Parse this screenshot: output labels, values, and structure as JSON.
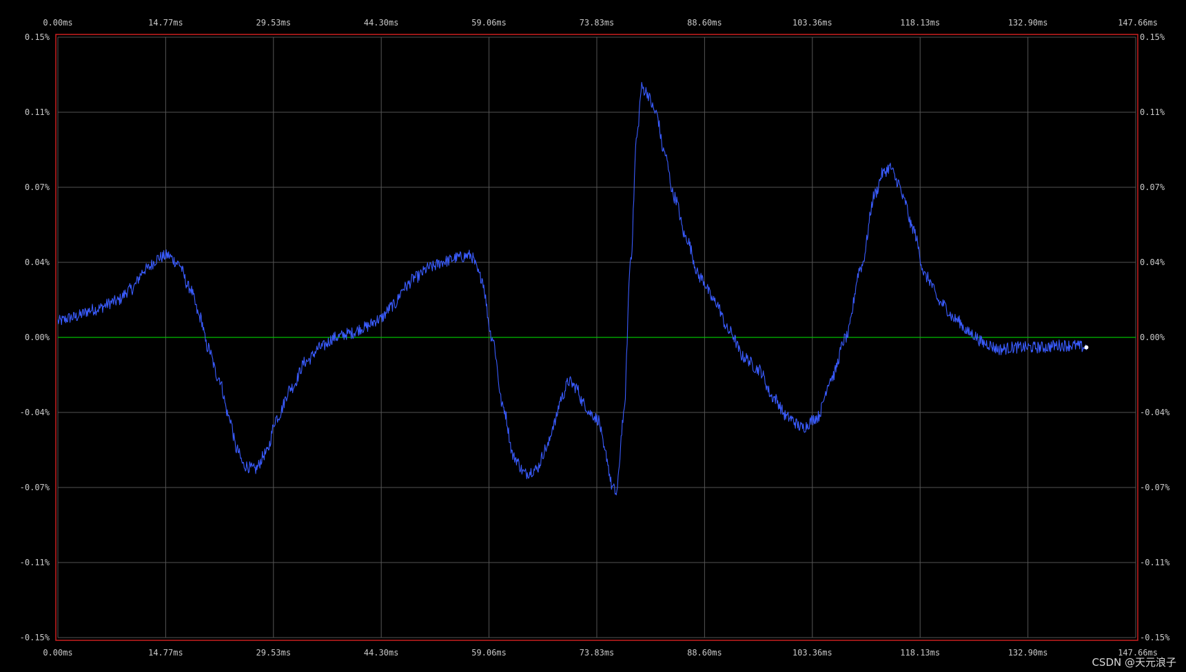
{
  "chart_data": {
    "type": "line",
    "title": "",
    "xlabel": "",
    "ylabel": "",
    "x_unit": "ms",
    "y_unit": "%",
    "xlim": [
      0,
      147.66
    ],
    "ylim": [
      -0.15,
      0.15
    ],
    "x_ticks": [
      "0.00ms",
      "14.77ms",
      "29.53ms",
      "44.30ms",
      "59.06ms",
      "73.83ms",
      "88.60ms",
      "103.36ms",
      "118.13ms",
      "132.90ms",
      "147.66ms"
    ],
    "y_ticks": [
      "0.15%",
      "0.11%",
      "0.07%",
      "0.04%",
      "0.00%",
      "-0.04%",
      "-0.07%",
      "-0.11%",
      "-0.15%"
    ],
    "grid": true,
    "reference_line": {
      "y": 0.0,
      "color": "#00c000"
    },
    "series": [
      {
        "color": "#3a5cff",
        "noise_amplitude": 0.003,
        "x": [
          0,
          2,
          5,
          8,
          10,
          12,
          14,
          15,
          16.5,
          18,
          19.5,
          20.5,
          22,
          23.5,
          24.5,
          25.5,
          27,
          28.5,
          30,
          32,
          34,
          36,
          38,
          40,
          42,
          44,
          46,
          47.5,
          49,
          51,
          53,
          55,
          56.5,
          58,
          59.5,
          61,
          62.5,
          64,
          65.5,
          67,
          68,
          69,
          70,
          71,
          72,
          73,
          74,
          75,
          76,
          76.5,
          77.5,
          78.5,
          79.3,
          80,
          80.5,
          82,
          83,
          84.5,
          86,
          88,
          90,
          92,
          94,
          96,
          98,
          100,
          102,
          104,
          106,
          108,
          110,
          112,
          113,
          114,
          115,
          116,
          117,
          119,
          121,
          123,
          125,
          127,
          129,
          131,
          133,
          135,
          137,
          139,
          140.9
        ],
        "y": [
          0.008,
          0.01,
          0.014,
          0.018,
          0.024,
          0.034,
          0.04,
          0.041,
          0.037,
          0.025,
          0.01,
          -0.005,
          -0.02,
          -0.04,
          -0.056,
          -0.064,
          -0.066,
          -0.058,
          -0.04,
          -0.025,
          -0.012,
          -0.005,
          0.0,
          0.002,
          0.005,
          0.009,
          0.016,
          0.025,
          0.03,
          0.035,
          0.038,
          0.04,
          0.041,
          0.03,
          0.0,
          -0.035,
          -0.06,
          -0.068,
          -0.066,
          -0.055,
          -0.043,
          -0.03,
          -0.022,
          -0.025,
          -0.033,
          -0.038,
          -0.041,
          -0.058,
          -0.075,
          -0.078,
          -0.04,
          0.04,
          0.1,
          0.125,
          0.123,
          0.112,
          0.093,
          0.07,
          0.05,
          0.03,
          0.018,
          0.003,
          -0.01,
          -0.016,
          -0.03,
          -0.04,
          -0.045,
          -0.04,
          -0.02,
          0.0,
          0.035,
          0.072,
          0.082,
          0.085,
          0.078,
          0.068,
          0.055,
          0.03,
          0.017,
          0.009,
          0.002,
          -0.003,
          -0.006,
          -0.005,
          -0.005,
          -0.005,
          -0.004,
          -0.004,
          -0.005
        ]
      }
    ],
    "end_marker": {
      "x": 140.9,
      "y": -0.005,
      "color": "#ffffff"
    }
  },
  "watermark": "CSDN @天元浪子",
  "colors": {
    "background": "#000000",
    "grid": "#555555",
    "frame": "#cc2020",
    "tick_text": "#c8c8c8"
  }
}
